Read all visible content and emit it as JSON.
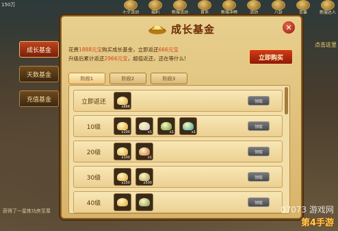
{
  "hud": {
    "hp_text": "150万",
    "right_hint": "点击这里",
    "chat_text": "获得了一星练功房至尊",
    "top_icons": [
      {
        "label": "七夕活动"
      },
      {
        "label": "福利"
      },
      {
        "label": "新服活动"
      },
      {
        "label": "首充"
      },
      {
        "label": "新服冲榜"
      },
      {
        "label": "活动"
      },
      {
        "label": "八卦"
      },
      {
        "label": "百兽"
      },
      {
        "label": "新服达人"
      }
    ]
  },
  "side_tabs": [
    {
      "label": "成长基金",
      "active": true
    },
    {
      "label": "天数基金",
      "active": false
    },
    {
      "label": "充值基金",
      "active": false
    }
  ],
  "panel": {
    "title": "成长基金",
    "close": "✕",
    "info_line1_a": "花费",
    "info_line1_amount": "1888元宝",
    "info_line1_b": "购买成长基金，",
    "info_line1_c": "立即返还",
    "info_line1_return": "666元宝",
    "info_line2_a": "升级后累计返还",
    "info_line2_total": "2966元宝",
    "info_line2_b": "，超值返还，还在等什么!",
    "buy_label": "立即购买",
    "stages": [
      {
        "label": "阶段1",
        "active": true
      },
      {
        "label": "阶段2",
        "active": false
      },
      {
        "label": "阶段3",
        "active": false
      }
    ],
    "rows": [
      {
        "level": "立即返还",
        "items": [
          {
            "count": "x666",
            "color": "#e0a63b"
          }
        ],
        "claim": "领取"
      },
      {
        "level": "10级",
        "items": [
          {
            "count": "x100",
            "color": "#e0a63b"
          },
          {
            "count": "x1",
            "color": "#c8c8c8"
          },
          {
            "count": "x1",
            "color": "#6a9a3a"
          },
          {
            "count": "x1",
            "color": "#3aa49a"
          }
        ],
        "claim": "领取"
      },
      {
        "level": "20级",
        "items": [
          {
            "count": "x100",
            "color": "#e0a63b"
          },
          {
            "count": "x1",
            "color": "#c86a3a"
          }
        ],
        "claim": "领取"
      },
      {
        "level": "30级",
        "items": [
          {
            "count": "x150",
            "color": "#e0a63b"
          },
          {
            "count": "x500",
            "color": "#b0a060"
          }
        ],
        "claim": "领取"
      },
      {
        "level": "40级",
        "items": [
          {
            "count": "",
            "color": "#e0a63b"
          },
          {
            "count": "",
            "color": "#8a9a5a"
          }
        ],
        "claim": "领取"
      }
    ]
  },
  "watermark": {
    "line1": "07073 游戏网",
    "line2": "第4手游"
  }
}
